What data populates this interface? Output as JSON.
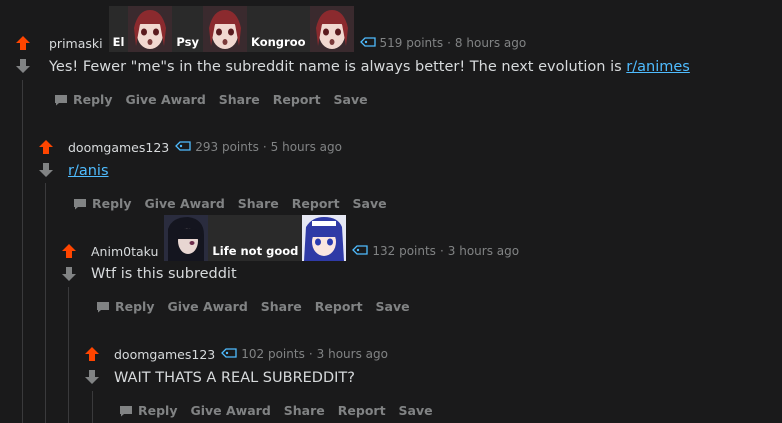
{
  "comments": [
    {
      "author": "primaski",
      "flair": [
        "El",
        "Psy",
        "Kongroo"
      ],
      "points": "519 points",
      "age": "8 hours ago",
      "body": "Yes! Fewer \"me\"s in the subreddit name is always better! The next evolution is ",
      "link": "r/animes"
    },
    {
      "author": "doomgames123",
      "points": "293 points",
      "age": "5 hours ago",
      "body": "",
      "link": "r/anis"
    },
    {
      "author": "Anim0taku",
      "flair": [
        "Life not good"
      ],
      "points": "132 points",
      "age": "3 hours ago",
      "body": "Wtf is this subreddit"
    },
    {
      "author": "doomgames123",
      "points": "102 points",
      "age": "3 hours ago",
      "body": "WAIT THATS A REAL SUBREDDIT?"
    }
  ],
  "actions": {
    "reply": "Reply",
    "give_award": "Give Award",
    "share": "Share",
    "report": "Report",
    "save": "Save"
  },
  "colors": {
    "background": "#1a1a1b",
    "upvote": "#ff4500",
    "downvote": "#818384",
    "link": "#4fbcff",
    "meta": "#818384",
    "text": "#d7dadc"
  }
}
